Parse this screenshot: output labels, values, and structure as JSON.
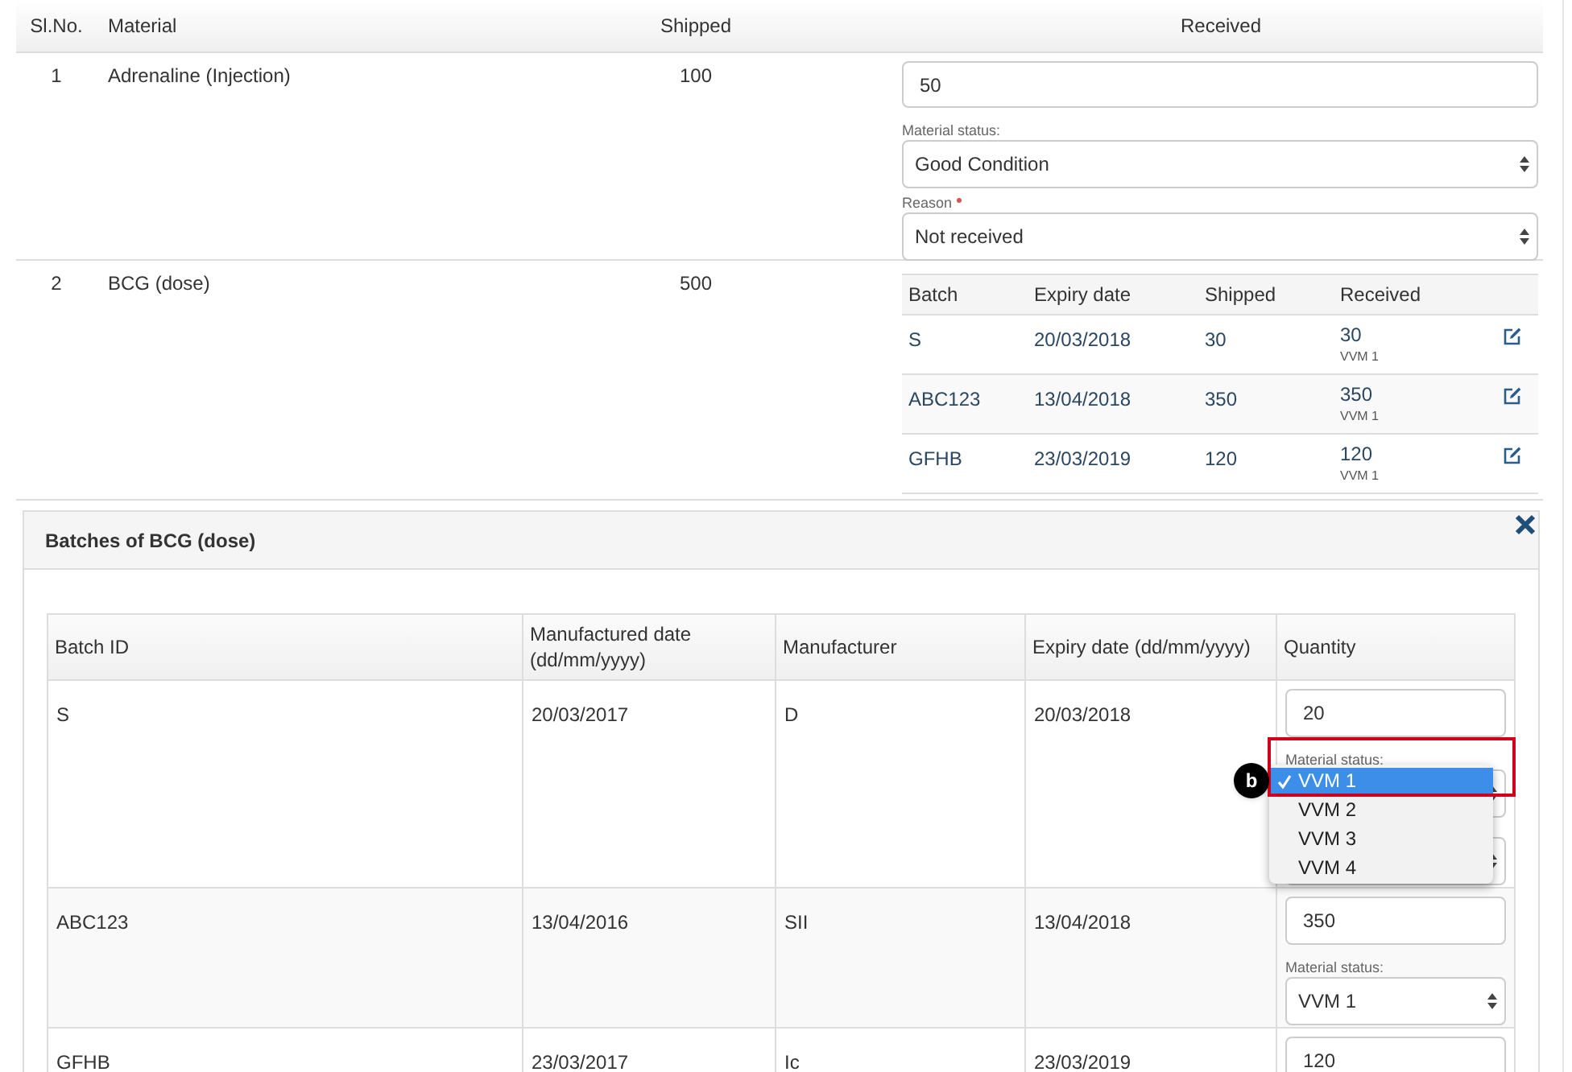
{
  "shipment_table": {
    "columns": [
      "Sl.No.",
      "Material",
      "Shipped",
      "Received"
    ],
    "rows": [
      {
        "kind": "single",
        "sl_no": "1",
        "material": "Adrenaline (Injection)",
        "shipped": "100",
        "received": {
          "value": "50",
          "status_label": "Material status:",
          "status": "Good Condition",
          "reason_label": "Reason",
          "reason_required": true,
          "reason": "Not received"
        }
      },
      {
        "kind": "batches",
        "sl_no": "2",
        "material": "BCG (dose)",
        "shipped": "500",
        "batch_table": {
          "columns": [
            "Batch",
            "Expiry date",
            "Shipped",
            "Received"
          ],
          "rows": [
            {
              "batch": "S",
              "expiry": "20/03/2018",
              "shipped": "30",
              "received": "30",
              "status": "VVM 1"
            },
            {
              "batch": "ABC123",
              "expiry": "13/04/2018",
              "shipped": "350",
              "received": "350",
              "status": "VVM 1"
            },
            {
              "batch": "GFHB",
              "expiry": "23/03/2019",
              "shipped": "120",
              "received": "120",
              "status": "VVM 1"
            }
          ]
        }
      }
    ]
  },
  "batches_panel": {
    "title": "Batches of BCG (dose)",
    "columns": [
      "Batch ID",
      "Manufactured date (dd/mm/yyyy)",
      "Manufacturer",
      "Expiry date (dd/mm/yyyy)",
      "Quantity"
    ],
    "rows": [
      {
        "batch_id": "S",
        "manufactured": "20/03/2017",
        "manufacturer": "D",
        "expiry": "20/03/2018",
        "quantity": "20",
        "status_label": "Material status:",
        "dropdown": {
          "open": true,
          "options": [
            {
              "label": "VVM 1",
              "selected": true
            },
            {
              "label": "VVM 2",
              "selected": false
            },
            {
              "label": "VVM 3",
              "selected": false
            },
            {
              "label": "VVM 4",
              "selected": false
            }
          ]
        }
      },
      {
        "batch_id": "ABC123",
        "manufactured": "13/04/2016",
        "manufacturer": "SII",
        "expiry": "13/04/2018",
        "quantity": "350",
        "status_label": "Material status:",
        "status": "VVM 1"
      },
      {
        "batch_id": "GFHB",
        "manufactured": "23/03/2017",
        "manufacturer": "Ic",
        "expiry": "23/03/2019",
        "quantity": "120"
      }
    ]
  },
  "annotation": {
    "label": "b"
  }
}
